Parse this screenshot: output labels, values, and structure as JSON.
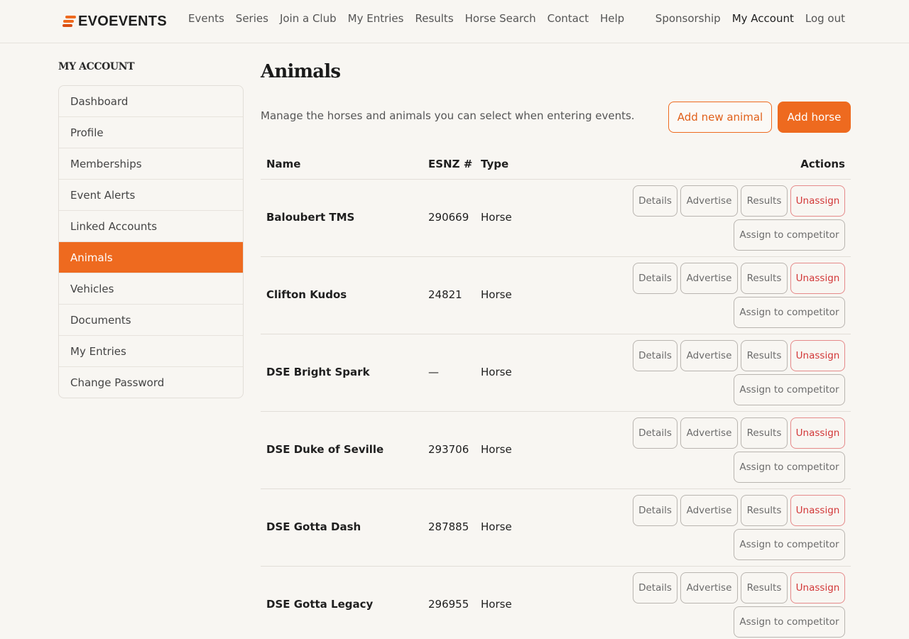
{
  "brand": {
    "name": "EVOEVENTS",
    "accent": "#ee6a1f"
  },
  "nav": {
    "main": [
      "Events",
      "Series",
      "Join a Club",
      "My Entries",
      "Results",
      "Horse Search",
      "Contact",
      "Help"
    ],
    "right": [
      "Sponsorship",
      "My Account",
      "Log out"
    ]
  },
  "sidebar": {
    "title": "MY ACCOUNT",
    "items": [
      "Dashboard",
      "Profile",
      "Memberships",
      "Event Alerts",
      "Linked Accounts",
      "Animals",
      "Vehicles",
      "Documents",
      "My Entries",
      "Change Password"
    ],
    "active": "Animals"
  },
  "page": {
    "title": "Animals",
    "intro": "Manage the horses and animals you can select when entering events.",
    "add_animal_label": "Add new animal",
    "add_horse_label": "Add horse"
  },
  "table": {
    "headers": {
      "name": "Name",
      "esnz": "ESNZ #",
      "type": "Type",
      "actions": "Actions"
    },
    "action_labels": {
      "details": "Details",
      "advertise": "Advertise",
      "results": "Results",
      "unassign": "Unassign",
      "assign": "Assign to competitor"
    },
    "rows": [
      {
        "name": "Baloubert TMS",
        "esnz": "290669",
        "type": "Horse"
      },
      {
        "name": "Clifton Kudos",
        "esnz": "24821",
        "type": "Horse"
      },
      {
        "name": "DSE Bright Spark",
        "esnz": "—",
        "type": "Horse"
      },
      {
        "name": "DSE Duke of Seville",
        "esnz": "293706",
        "type": "Horse"
      },
      {
        "name": "DSE Gotta Dash",
        "esnz": "287885",
        "type": "Horse"
      },
      {
        "name": "DSE Gotta Legacy",
        "esnz": "296955",
        "type": "Horse"
      }
    ]
  }
}
